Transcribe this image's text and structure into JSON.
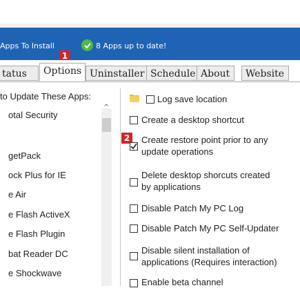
{
  "status": {
    "apps_to_install": "Apps To Install",
    "up_to_date": "8 Apps up to date!"
  },
  "markers": {
    "m1": "1",
    "m2": "2"
  },
  "tabs": [
    "tatus",
    "Options",
    "Uninstaller",
    "Schedule",
    "About",
    "Website"
  ],
  "left": {
    "title": "to Update These Apps:",
    "apps": [
      "otal Security",
      "getPack",
      "ock Plus for IE",
      "e Air",
      "e Flash ActiveX",
      "e Flash Plugin",
      "bat Reader DC",
      "e Shockwave"
    ]
  },
  "options": [
    "Log save location",
    "Create a desktop shortcut",
    "Create restore point prior to any update operations",
    "Delete desktop shorcuts created by applications",
    "Disable Patch My PC Log",
    "Disable Patch My PC Self-Updater",
    "Disable silent installation of applications (Requires interaction)",
    "Enable beta channel"
  ],
  "option_lines": {
    "o2a": "Create restore point prior to any",
    "o2b": "update operations",
    "o3a": "Delete desktop shorcuts created",
    "o3b": "by applications",
    "o6a": "Disable silent installation of",
    "o6b": "applications (Requires interaction)"
  },
  "colors": {
    "accent": "#1f63b4",
    "marker": "#d8232a",
    "ok": "#4fb848"
  }
}
